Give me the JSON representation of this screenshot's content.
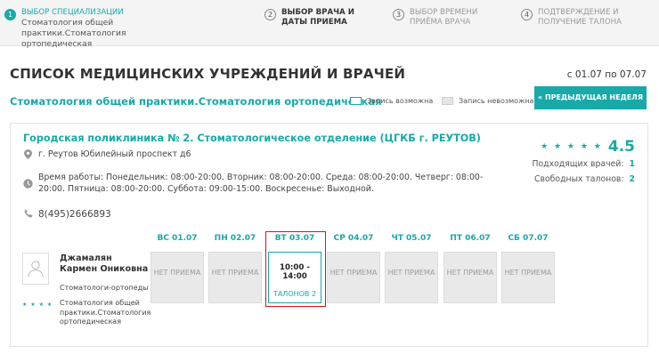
{
  "stepper": {
    "steps": [
      {
        "num": "1",
        "label": "Выбор специализации",
        "sub": "Стоматология общей практики.Стоматология ортопедическая"
      },
      {
        "num": "2",
        "label": "Выбор врача и даты приема",
        "sub": ""
      },
      {
        "num": "3",
        "label": "Выбор времени приёма врача",
        "sub": ""
      },
      {
        "num": "4",
        "label": "Подтверждение и получение талона",
        "sub": ""
      }
    ]
  },
  "header": {
    "title": "СПИСОК МЕДИЦИНСКИХ УЧРЕЖДЕНИЙ И ВРАЧЕЙ",
    "date_range": "с 01.07 по 07.07",
    "specialization": "Стоматология общей практики.Стоматология ортопедическая",
    "legend_possible": "Запись возможна",
    "legend_impossible": "Запись невозможна",
    "prev_week_button": "« ПРЕДЫДУЩАЯ НЕДЕЛЯ"
  },
  "clinic": {
    "name": "Городская поликлиника № 2. Стоматологическое отделение (ЦГКБ г. РЕУТОВ)",
    "address": "г. Реутов Юбилейный проспект д6",
    "hours": "Время работы: Понедельник: 08:00-20:00. Вторник: 08:00-20:00. Среда: 08:00-20:00. Четверг: 08:00-20:00. Пятница: 08:00-20:00. Суббота: 09:00-15:00. Воскресенье: Выходной.",
    "phone": "8(495)2666893",
    "rating": "4.5",
    "stars": "★ ★ ★ ★ ★",
    "matching_doctors_label": "Подходящих врачей:",
    "matching_doctors": "1",
    "free_tickets_label": "Свободных талонов:",
    "free_tickets": "2"
  },
  "doctor": {
    "name": "Джамалян Кармен Ониковна",
    "specialty": "Стоматологи-ортопеды",
    "stars": "★ ★ ★ ★",
    "specialization": "Стоматология общей практики.Стоматология ортопедическая"
  },
  "schedule": [
    {
      "day": "ВС 01.07",
      "status": "НЕТ ПРИЕМА"
    },
    {
      "day": "ПН 02.07",
      "status": "НЕТ ПРИЕМА"
    },
    {
      "day": "ВТ 03.07",
      "time": "10:00 - 14:00",
      "tickets": "ТАЛОНОВ 2"
    },
    {
      "day": "СР 04.07",
      "status": "НЕТ ПРИЕМА"
    },
    {
      "day": "ЧТ 05.07",
      "status": "НЕТ ПРИЕМА"
    },
    {
      "day": "ПТ 06.07",
      "status": "НЕТ ПРИЕМА"
    },
    {
      "day": "СБ 07.07",
      "status": "НЕТ ПРИЕМА"
    }
  ],
  "colors": {
    "accent": "#18a9a8",
    "highlight": "#dd1111"
  }
}
